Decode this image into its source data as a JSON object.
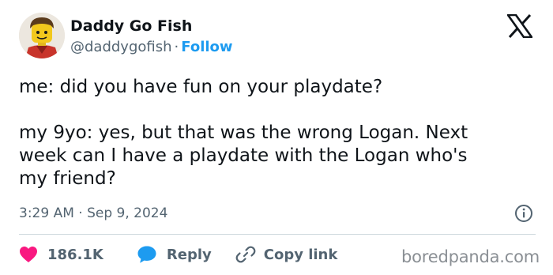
{
  "author": {
    "display_name": "Daddy Go Fish",
    "handle": "@daddygofish",
    "separator": "·",
    "follow_label": "Follow"
  },
  "tweet": {
    "lines": [
      "me: did you have fun on your playdate?",
      "my 9yo: yes, but that was the wrong Logan. Next",
      "week can I have a playdate with the Logan who's",
      "my friend?"
    ],
    "timestamp": "3:29 AM · Sep 9, 2024"
  },
  "actions": {
    "likes_count": "186.1K",
    "reply_label": "Reply",
    "copy_link_label": "Copy link"
  },
  "watermark": "boredpanda.com",
  "icons": {
    "avatar": "lego-minifigure-avatar",
    "logo": "x-logo-icon",
    "info": "info-icon",
    "like": "heart-icon",
    "reply": "speech-bubble-icon",
    "copy": "link-icon"
  },
  "colors": {
    "text_primary": "#0f1419",
    "text_secondary": "#536471",
    "follow_blue": "#1d9bf0",
    "heart_pink": "#f91880",
    "reply_blue": "#1d9bf0",
    "divider": "#cfd9de"
  }
}
